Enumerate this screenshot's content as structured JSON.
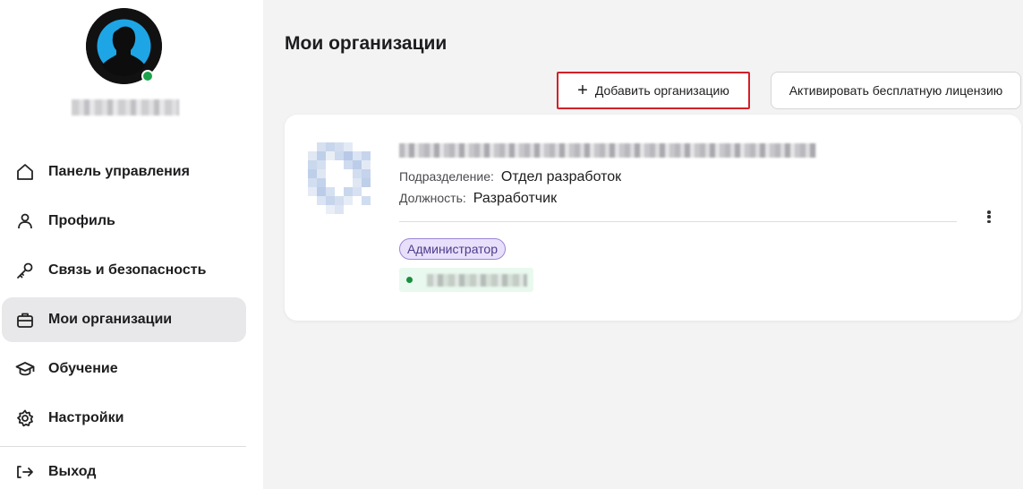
{
  "sidebar": {
    "user_status": "online",
    "items": [
      {
        "label": "Панель управления",
        "icon": "home-icon",
        "active": false
      },
      {
        "label": "Профиль",
        "icon": "user-icon",
        "active": false
      },
      {
        "label": "Связь и безопасность",
        "icon": "key-icon",
        "active": false
      },
      {
        "label": "Мои организации",
        "icon": "briefcase-icon",
        "active": true
      },
      {
        "label": "Обучение",
        "icon": "graduation-cap-icon",
        "active": false
      },
      {
        "label": "Настройки",
        "icon": "gear-icon",
        "active": false
      },
      {
        "label": "Выход",
        "icon": "logout-icon",
        "active": false
      }
    ]
  },
  "main": {
    "title": "Мои организации",
    "add_button": {
      "icon": "+",
      "label": "Добавить организацию"
    },
    "activate_button": {
      "label": "Активировать бесплатную лицензию"
    },
    "organizations": [
      {
        "department_label": "Подразделение:",
        "department": "Отдел разработок",
        "position_label": "Должность:",
        "position": "Разработчик",
        "role": "Администратор"
      }
    ]
  },
  "colors": {
    "accent_active_bg": "#e8e8ea",
    "highlight_border": "#d32027",
    "online": "#1aa34a",
    "badge_bg": "#e8e0fb",
    "badge_border": "#9a85d6"
  }
}
